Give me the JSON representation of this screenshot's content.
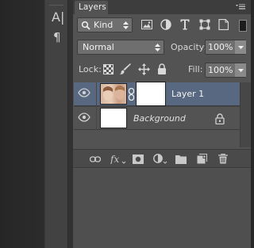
{
  "panel": {
    "tab_label": "Layers",
    "menu_icon": "panel-menu-icon"
  },
  "tools": {
    "text_tool_glyph": "A|",
    "paragraph_glyph": "¶"
  },
  "filter": {
    "kind_label": "Kind",
    "icons": [
      "pixel-layer-filter-icon",
      "adjustment-filter-icon",
      "type-filter-icon",
      "shape-filter-icon",
      "smart-object-filter-icon"
    ]
  },
  "blend": {
    "mode": "Normal",
    "opacity_label": "Opacity:",
    "opacity_value": "100%"
  },
  "locks": {
    "label": "Lock:",
    "fill_label": "Fill:",
    "fill_value": "100%"
  },
  "layers": [
    {
      "name": "Layer 1",
      "selected": true,
      "visible": true,
      "has_mask": true
    },
    {
      "name": "Background",
      "selected": false,
      "visible": true,
      "locked": true
    }
  ],
  "footer_icons": [
    "link-layers-icon",
    "fx-icon",
    "add-mask-icon",
    "adjustment-layer-icon",
    "new-group-icon",
    "new-layer-icon",
    "delete-layer-icon"
  ],
  "colors": {
    "panel": "#535353",
    "selection": "#586880",
    "toolbar": "#424242"
  }
}
